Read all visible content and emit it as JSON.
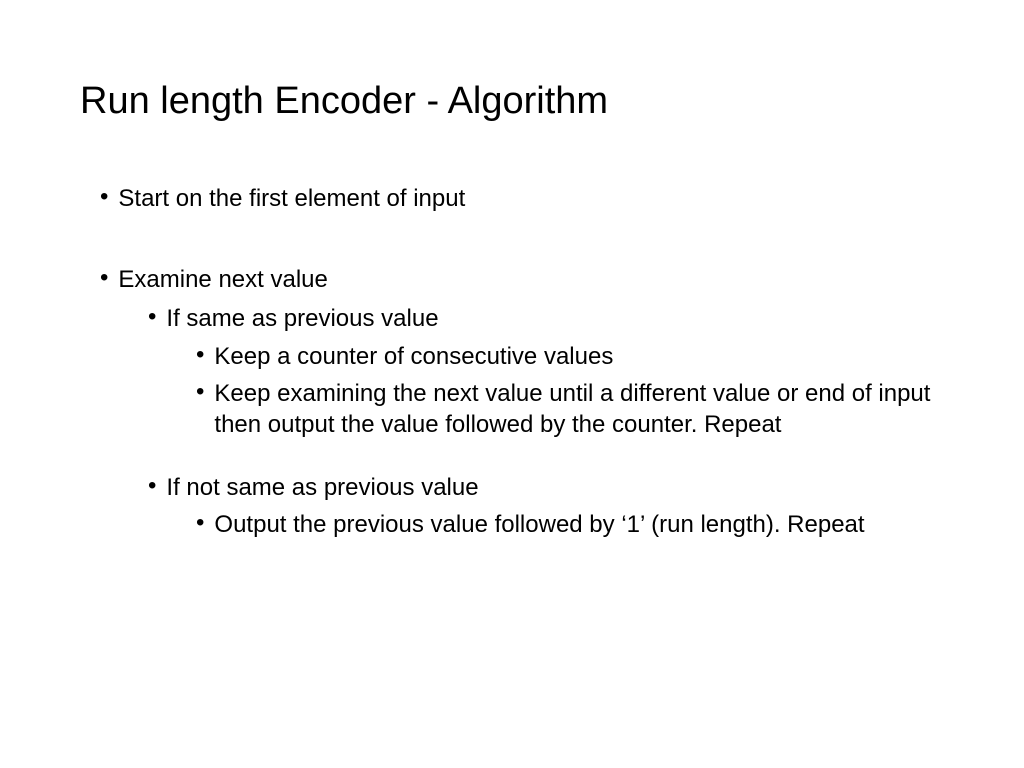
{
  "slide": {
    "title": "Run length Encoder - Algorithm",
    "bullets": {
      "b1": "Start on the first element of input",
      "b2": "Examine next value",
      "b2a": "If same as previous value",
      "b2a1": "Keep a counter of consecutive values",
      "b2a2": "Keep examining the next value until a different value or end of input then output the value followed by the counter. Repeat",
      "b2b": "If not same as previous value",
      "b2b1": "Output the previous value followed by ‘1’ (run length). Repeat"
    }
  }
}
